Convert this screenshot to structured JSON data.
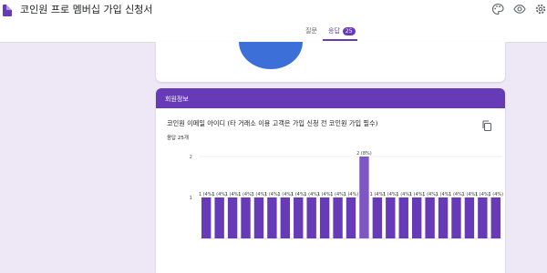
{
  "header": {
    "doc_title": "코인원 프로 멤버십 가입 신청서",
    "icons": [
      "doc-icon",
      "palette-icon",
      "eye-icon",
      "settings-icon"
    ]
  },
  "tabs": [
    {
      "label": "질문",
      "active": false
    },
    {
      "label": "응답",
      "active": true,
      "badge": "25"
    }
  ],
  "section": {
    "title": "회원정보",
    "question": "코인원 이메일 아이디 (타 거래소 이용 고객은 가입 신청 전 코인원 가입 필수)",
    "response_count": "응답 25개",
    "copy_icon": "copy-icon"
  },
  "colors": {
    "accent": "#673ab7",
    "background": "#ede7f6",
    "bar": "#673ab7",
    "bar_highlight": "#7e57c2",
    "pie": "#3d6fd9"
  },
  "chart_data": {
    "type": "bar",
    "ylim": [
      0,
      2
    ],
    "yticks": [
      "1",
      "2"
    ],
    "grid": true,
    "values": [
      1,
      1,
      1,
      1,
      1,
      1,
      1,
      1,
      1,
      1,
      1,
      1,
      2,
      1,
      1,
      1,
      1,
      1,
      1,
      1,
      1,
      1,
      1
    ],
    "data_labels": [
      "1 (4%)",
      "1 (4%)",
      "1 (4%)",
      "1 (4%)",
      "1 (4%)",
      "1 (4%)",
      "1 (4%)",
      "1 (4%)",
      "1 (4%)",
      "1 (4%)",
      "1 (4%)",
      "1 (4%)",
      "2 (8%)",
      "1 (4%)",
      "1 (4%)",
      "1 (4%)",
      "1 (4%)",
      "1 (4%)",
      "1 (4%)",
      "1 (4%)",
      "1 (4%)",
      "1 (4%)",
      "1 (4%)"
    ],
    "highlight_index": 12
  }
}
